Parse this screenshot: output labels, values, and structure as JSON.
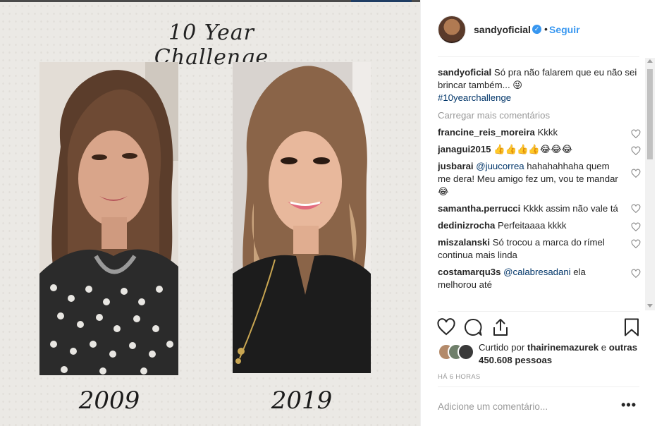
{
  "image": {
    "title": "10 Year Challenge",
    "left_year": "2009",
    "right_year": "2019"
  },
  "post": {
    "username": "sandyoficial",
    "separator": "•",
    "follow_label": "Seguir",
    "caption_text": "Só pra não falarem que eu não sei brincar também... 😜",
    "caption_hashtag": "#10yearchallenge",
    "load_more": "Carregar mais comentários",
    "comments": [
      {
        "user": "francine_reis_moreira",
        "text": "Kkkk"
      },
      {
        "user": "janagui2015",
        "text": "👍👍👍👍😂😂😂"
      },
      {
        "user": "jusbarai",
        "mention": "@juucorrea",
        "text": " hahahahhaha quem me dera! Meu amigo fez um, vou te mandar 😂"
      },
      {
        "user": "samantha.perrucci",
        "text": "Kkkk assim não vale tá"
      },
      {
        "user": "dedinizrocha",
        "text": "Perfeitaaaa kkkk"
      },
      {
        "user": "miszalanski",
        "text": "Só trocou a marca do rímel continua mais linda"
      },
      {
        "user": "costamarqu3s",
        "mention": "@calabresadani",
        "text": " ela melhorou até"
      }
    ],
    "liked_prefix": "Curtido por",
    "liked_user": "thairinemazurek",
    "liked_and": "e",
    "liked_others": "outras 450.608 pessoas",
    "timestamp": "HÁ 6 HORAS",
    "comment_placeholder": "Adicione um comentário...",
    "more_options": "•••"
  },
  "icons": {
    "like": "heart-icon",
    "comment": "comment-icon",
    "share": "share-icon",
    "save": "bookmark-icon",
    "verified": "verified-badge-icon"
  },
  "colors": {
    "link_blue": "#3897f0",
    "hashtag_blue": "#003569",
    "muted_gray": "#999999",
    "paper_bg": "#ebe9e5"
  }
}
